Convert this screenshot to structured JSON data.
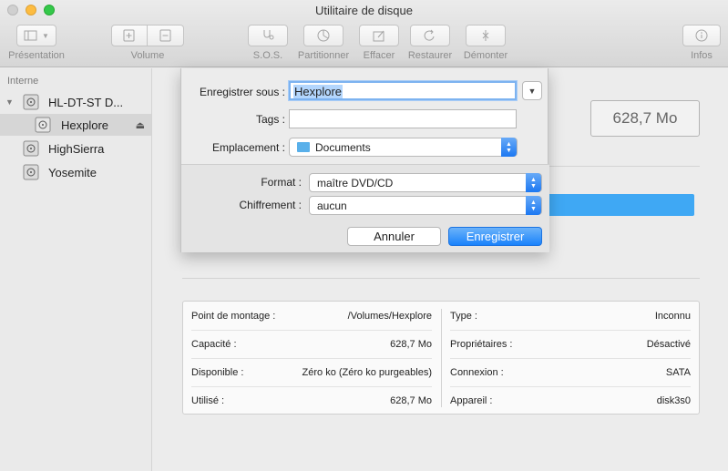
{
  "window": {
    "title": "Utilitaire de disque"
  },
  "toolbar": {
    "presentation": "Présentation",
    "volume": "Volume",
    "sos": "S.O.S.",
    "partition": "Partitionner",
    "erase": "Effacer",
    "restore": "Restaurer",
    "unmount": "Démonter",
    "info": "Infos"
  },
  "sidebar": {
    "section": "Interne",
    "items": [
      {
        "label": "HL-DT-ST D..."
      },
      {
        "label": "Hexplore"
      },
      {
        "label": "HighSierra"
      },
      {
        "label": "Yosemite"
      }
    ]
  },
  "main": {
    "size": "628,7 Mo",
    "info": {
      "rows": [
        {
          "left_label": "Point de montage :",
          "left_value": "/Volumes/Hexplore",
          "right_label": "Type :",
          "right_value": "Inconnu"
        },
        {
          "left_label": "Capacité :",
          "left_value": "628,7 Mo",
          "right_label": "Propriétaires :",
          "right_value": "Désactivé"
        },
        {
          "left_label": "Disponible :",
          "left_value": "Zéro ko (Zéro ko purgeables)",
          "right_label": "Connexion :",
          "right_value": "SATA"
        },
        {
          "left_label": "Utilisé :",
          "left_value": "628,7 Mo",
          "right_label": "Appareil :",
          "right_value": "disk3s0"
        }
      ]
    }
  },
  "sheet": {
    "save_as_label": "Enregistrer sous :",
    "save_as_value": "Hexplore",
    "tags_label": "Tags :",
    "tags_value": "",
    "location_label": "Emplacement :",
    "location_value": "Documents",
    "format_label": "Format :",
    "format_value": "maître DVD/CD",
    "encryption_label": "Chiffrement :",
    "encryption_value": "aucun",
    "cancel": "Annuler",
    "save": "Enregistrer"
  }
}
